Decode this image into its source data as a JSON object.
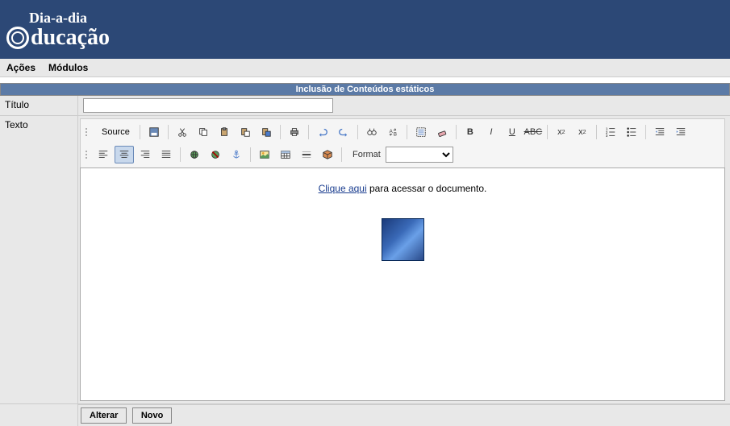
{
  "logo": {
    "top": "Dia-a-dia",
    "bottom": "ducação"
  },
  "menu": {
    "acoes": "Ações",
    "modulos": "Módulos"
  },
  "title_bar": "Inclusão de Conteúdos estáticos",
  "labels": {
    "titulo": "Título",
    "texto": "Texto"
  },
  "fields": {
    "titulo_value": ""
  },
  "toolbar": {
    "source": "Source",
    "format_label": "Format",
    "format_value": ""
  },
  "editor": {
    "link_text": "Clique aqui",
    "rest_text": " para acessar o documento."
  },
  "buttons": {
    "alterar": "Alterar",
    "novo": "Novo"
  }
}
